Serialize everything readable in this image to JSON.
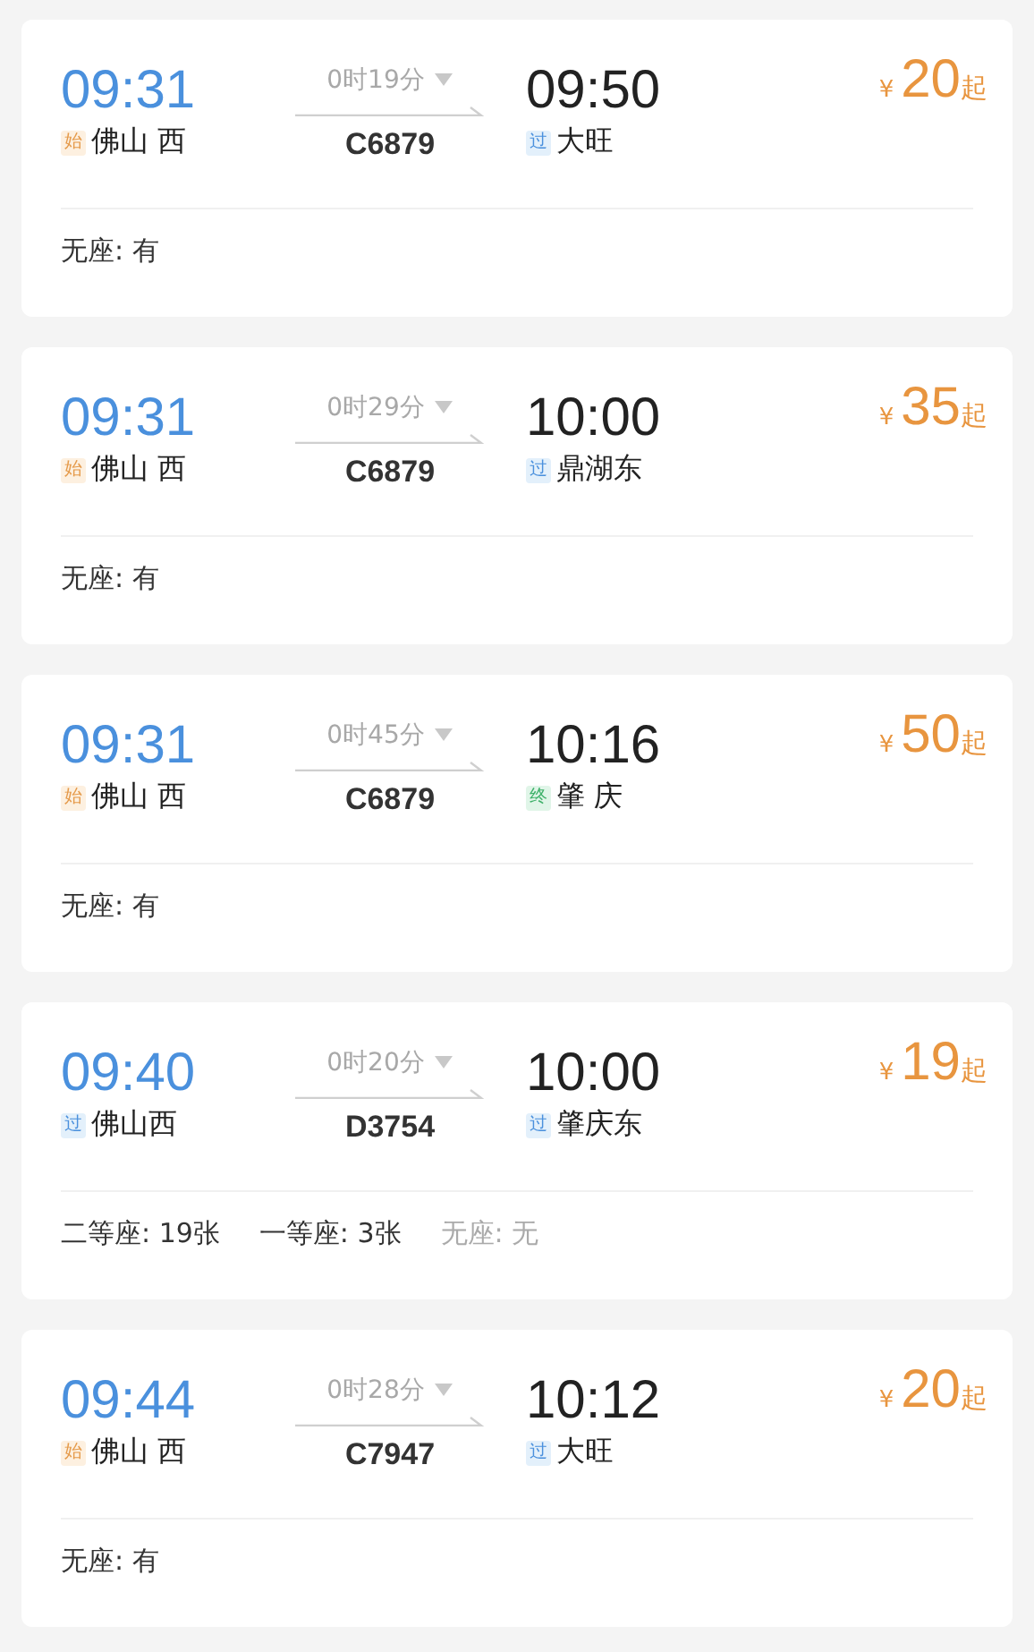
{
  "trains": [
    {
      "depart_time": "09:31",
      "depart_station": {
        "badge": "始",
        "kind": "start",
        "name": "佛山 西"
      },
      "duration": "0时19分",
      "number": "C6879",
      "arrive_time": "09:50",
      "arrive_station": {
        "badge": "过",
        "kind": "pass",
        "name": "大旺"
      },
      "currency": "¥",
      "price": "20",
      "price_suffix": "起",
      "seats": [
        {
          "text": "无座: 有",
          "available": true
        }
      ]
    },
    {
      "depart_time": "09:31",
      "depart_station": {
        "badge": "始",
        "kind": "start",
        "name": "佛山 西"
      },
      "duration": "0时29分",
      "number": "C6879",
      "arrive_time": "10:00",
      "arrive_station": {
        "badge": "过",
        "kind": "pass",
        "name": "鼎湖东"
      },
      "currency": "¥",
      "price": "35",
      "price_suffix": "起",
      "seats": [
        {
          "text": "无座: 有",
          "available": true
        }
      ]
    },
    {
      "depart_time": "09:31",
      "depart_station": {
        "badge": "始",
        "kind": "start",
        "name": "佛山 西"
      },
      "duration": "0时45分",
      "number": "C6879",
      "arrive_time": "10:16",
      "arrive_station": {
        "badge": "终",
        "kind": "end",
        "name": "肇 庆"
      },
      "currency": "¥",
      "price": "50",
      "price_suffix": "起",
      "seats": [
        {
          "text": "无座: 有",
          "available": true
        }
      ]
    },
    {
      "depart_time": "09:40",
      "depart_station": {
        "badge": "过",
        "kind": "pass",
        "name": "佛山西"
      },
      "duration": "0时20分",
      "number": "D3754",
      "arrive_time": "10:00",
      "arrive_station": {
        "badge": "过",
        "kind": "pass",
        "name": "肇庆东"
      },
      "currency": "¥",
      "price": "19",
      "price_suffix": "起",
      "seats": [
        {
          "text": "二等座: 19张",
          "available": true
        },
        {
          "text": "一等座: 3张",
          "available": true
        },
        {
          "text": "无座: 无",
          "available": false
        }
      ]
    },
    {
      "depart_time": "09:44",
      "depart_station": {
        "badge": "始",
        "kind": "start",
        "name": "佛山 西"
      },
      "duration": "0时28分",
      "number": "C7947",
      "arrive_time": "10:12",
      "arrive_station": {
        "badge": "过",
        "kind": "pass",
        "name": "大旺"
      },
      "currency": "¥",
      "price": "20",
      "price_suffix": "起",
      "seats": [
        {
          "text": "无座: 有",
          "available": true
        }
      ]
    }
  ]
}
